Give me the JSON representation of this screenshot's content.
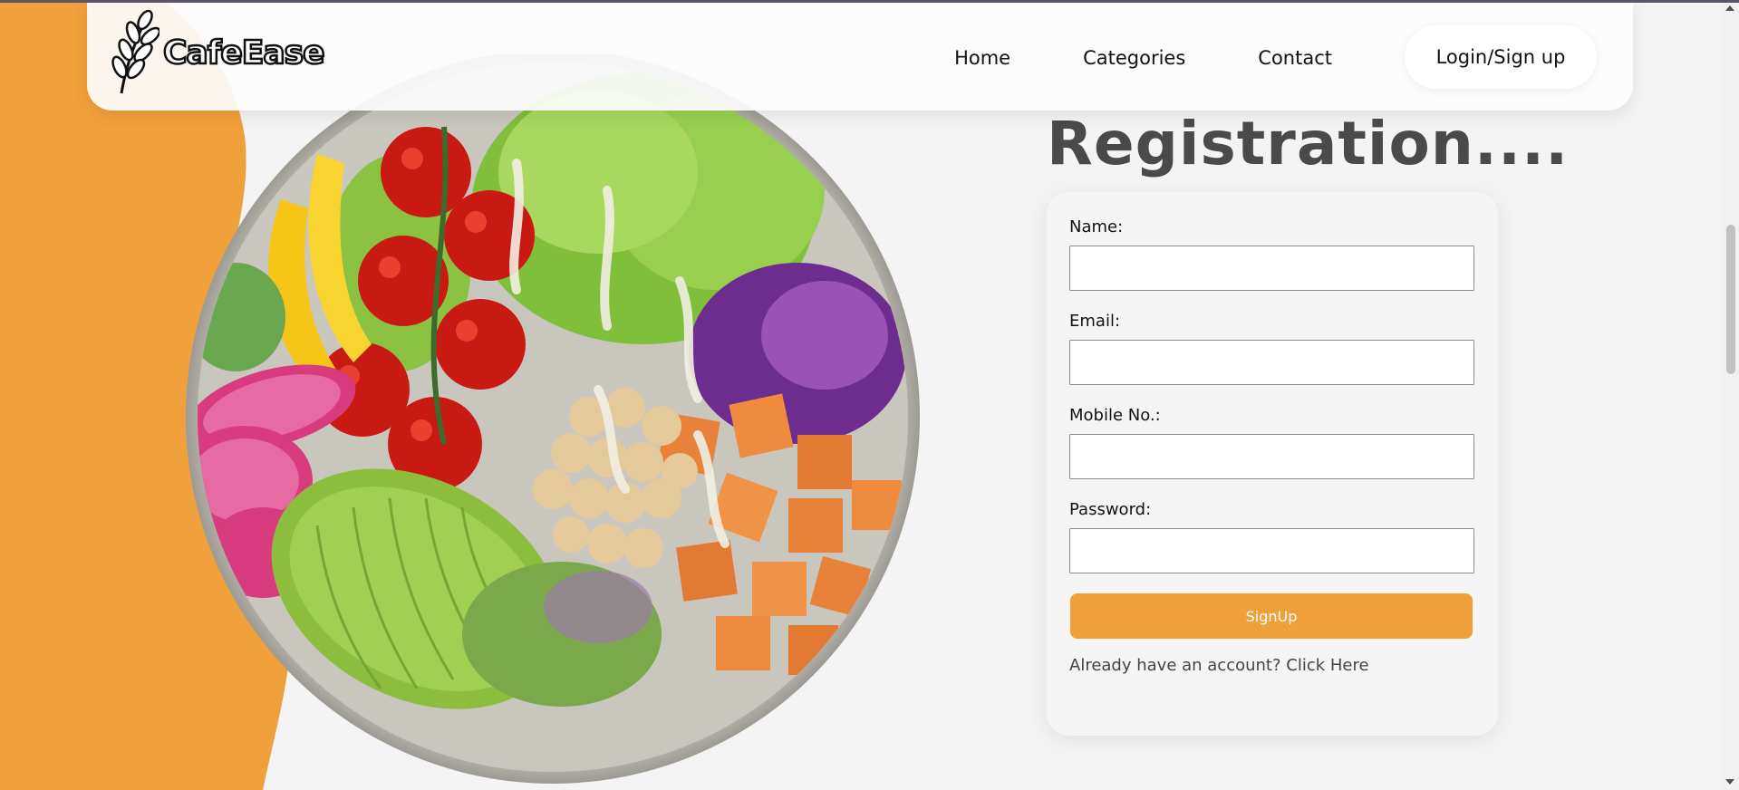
{
  "brand": {
    "name": "CafeEase"
  },
  "nav": {
    "items": [
      {
        "label": "Home"
      },
      {
        "label": "Categories"
      },
      {
        "label": "Contact"
      }
    ],
    "login_label": "Login/Sign up"
  },
  "registration": {
    "title": "Registration....",
    "fields": [
      {
        "label": "Name:",
        "value": "",
        "placeholder": ""
      },
      {
        "label": "Email:",
        "value": "",
        "placeholder": ""
      },
      {
        "label": "Mobile No.:",
        "value": "",
        "placeholder": ""
      },
      {
        "label": "Password:",
        "value": "",
        "placeholder": ""
      }
    ],
    "submit_label": "SignUp",
    "login_prompt": "Already have an account? Click Here"
  },
  "colors": {
    "accent": "#f0a03a",
    "page_background": "#f4f4f4",
    "title_text": "#4a4a4a"
  },
  "icons": {
    "logo": "wheat-icon"
  }
}
